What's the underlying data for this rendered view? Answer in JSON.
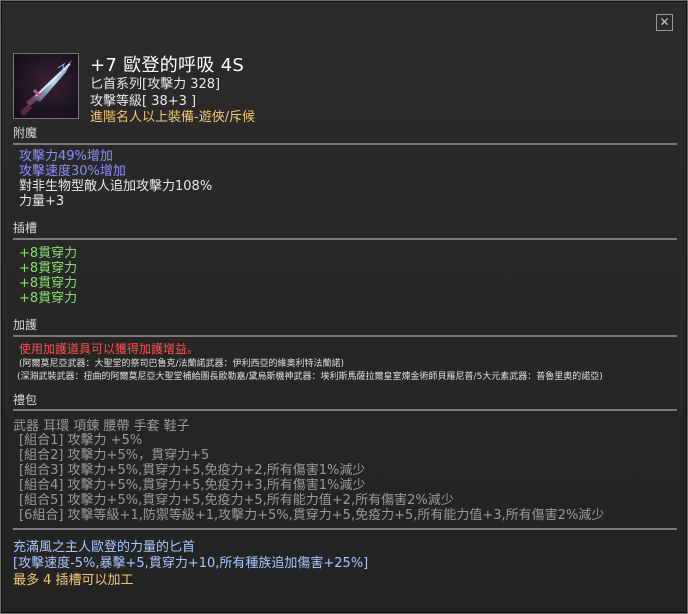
{
  "close_icon": "close-icon",
  "item": {
    "name": "+7 歐登的呼吸 4S",
    "type_line": "匕首系列[攻擊力 328]",
    "level_line": "攻擊等級[ 38+3 ]",
    "requirement": "進階名人以上裝備-遊俠/斥候"
  },
  "sections": {
    "enchant": {
      "label": "附魔",
      "lines": [
        {
          "text": "攻擊力49%增加",
          "color": "#8c8cff"
        },
        {
          "text": "攻擊速度30%增加",
          "color": "#8c8cff"
        },
        {
          "text": "對非生物型敵人追加攻擊力108%",
          "color": "#e8e8e8"
        },
        {
          "text": "力量+3",
          "color": "#e8e8e8"
        }
      ]
    },
    "slots": {
      "label": "插槽",
      "lines": [
        "+8貫穿力",
        "+8貫穿力",
        "+8貫穿力",
        "+8貫穿力"
      ]
    },
    "protect": {
      "label": "加護",
      "warning": "使用加護道具可以獲得加護增益。",
      "note1": "(阿爾莫尼亞武器：大聖堂的祭司巴魯克/法蘭諾武器：伊利西亞的維奧利特法蘭諾)",
      "note2": "(深淵武裝武器：扭曲的阿爾莫尼亞大聖堂補給團長歐勒嘉/黛烏斯機神武器：埃利斯馬薩拉爾皇室煉金術師貝羅尼普/5大元素武器：普魯里奧的諾亞)"
    },
    "set": {
      "label": "禮包",
      "parts": "武器 耳環 項鍊 腰帶 手套 鞋子",
      "combos": [
        "[組合1] 攻擊力 +5%",
        "[組合2] 攻擊力+5%，貫穿力+5",
        "[組合3] 攻擊力+5%,貫穿力+5,免疫力+2,所有傷害1%減少",
        "[組合4] 攻擊力+5%,貫穿力+5,免疫力+3,所有傷害1%減少",
        "[組合5] 攻擊力+5%,貫穿力+5,免疫力+5,所有能力值+2,所有傷害2%減少",
        "[6組合] 攻擊等級+1,防禦等級+1,攻擊力+5%,貫穿力+5,免疫力+5,所有能力值+3,所有傷害2%減少"
      ]
    }
  },
  "bottom": {
    "line1": "充滿風之主人歐登的力量的匕首",
    "line2": "[攻擊速度-5%,暴擊+5,貫穿力+10,所有種族追加傷害+25%]",
    "line3": "最多 4 插槽可以加工"
  }
}
